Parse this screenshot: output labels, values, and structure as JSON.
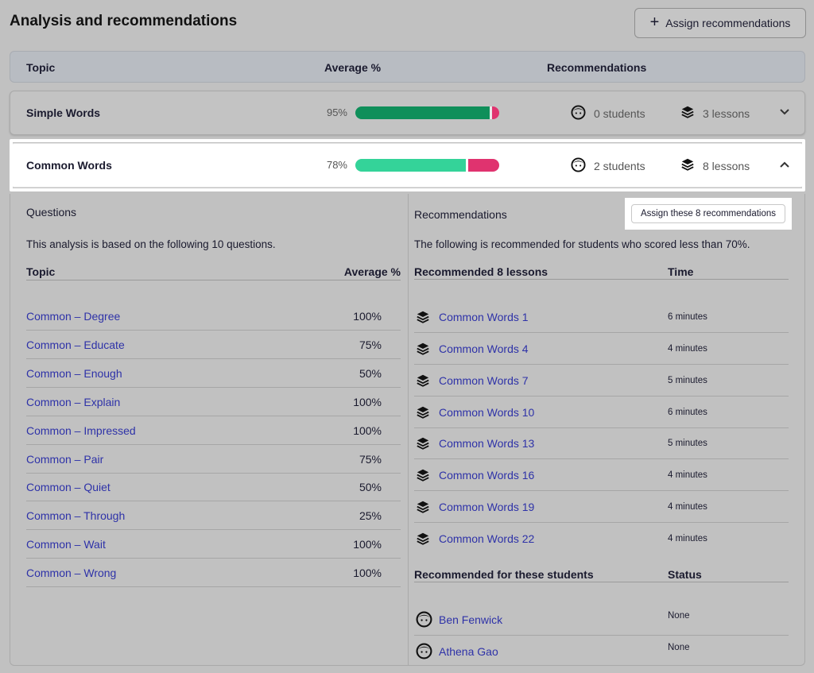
{
  "page": {
    "title": "Analysis and recommendations",
    "assign_button": "Assign recommendations"
  },
  "table_header": {
    "topic": "Topic",
    "average": "Average %",
    "recommendations": "Recommendations"
  },
  "topics": [
    {
      "name": "Simple Words",
      "percent": "95%",
      "score_fraction": 0.95,
      "students": "0 students",
      "lessons": "3 lessons",
      "expanded": false
    },
    {
      "name": "Common Words",
      "percent": "78%",
      "score_fraction": 0.78,
      "students": "2 students",
      "lessons": "8 lessons",
      "expanded": true
    }
  ],
  "colors": {
    "simple_bar_green": "#0f8f5a",
    "common_bar_green": "#34d399",
    "bar_red": "#e0336f",
    "link": "#2e32a8",
    "background": "#c1c1c1"
  },
  "questions": {
    "title": "Questions",
    "description": "This analysis is based on the following 10 questions.",
    "col_topic": "Topic",
    "col_average": "Average %",
    "rows": [
      {
        "name": "Common – Degree",
        "value": "100%"
      },
      {
        "name": "Common – Educate",
        "value": "75%"
      },
      {
        "name": "Common – Enough",
        "value": "50%"
      },
      {
        "name": "Common – Explain",
        "value": "100%"
      },
      {
        "name": "Common – Impressed",
        "value": "100%"
      },
      {
        "name": "Common – Pair",
        "value": "75%"
      },
      {
        "name": "Common – Quiet",
        "value": "50%"
      },
      {
        "name": "Common – Through",
        "value": "25%"
      },
      {
        "name": "Common – Wait",
        "value": "100%"
      },
      {
        "name": "Common – Wrong",
        "value": "100%"
      }
    ]
  },
  "recommendations": {
    "title": "Recommendations",
    "assign_button": "Assign these 8 recommendations",
    "description": "The following is recommended for students who scored less than 70%.",
    "lessons_header": "Recommended 8 lessons",
    "time_header": "Time",
    "lessons": [
      {
        "name": "Common Words 1",
        "time": "6 minutes"
      },
      {
        "name": "Common Words 4",
        "time": "4 minutes"
      },
      {
        "name": "Common Words 7",
        "time": "5 minutes"
      },
      {
        "name": "Common Words 10",
        "time": "6 minutes"
      },
      {
        "name": "Common Words 13",
        "time": "5 minutes"
      },
      {
        "name": "Common Words 16",
        "time": "4 minutes"
      },
      {
        "name": "Common Words 19",
        "time": "4 minutes"
      },
      {
        "name": "Common Words 22",
        "time": "4 minutes"
      }
    ],
    "students_header": "Recommended for these students",
    "status_header": "Status",
    "students": [
      {
        "name": "Ben Fenwick",
        "status": "None"
      },
      {
        "name": "Athena Gao",
        "status": "None"
      }
    ]
  },
  "icons": {
    "student": "student-face-icon",
    "lessons": "layers-stack-icon",
    "collapse": "chevron-up-icon",
    "expand": "chevron-down-icon",
    "add": "plus-icon"
  }
}
